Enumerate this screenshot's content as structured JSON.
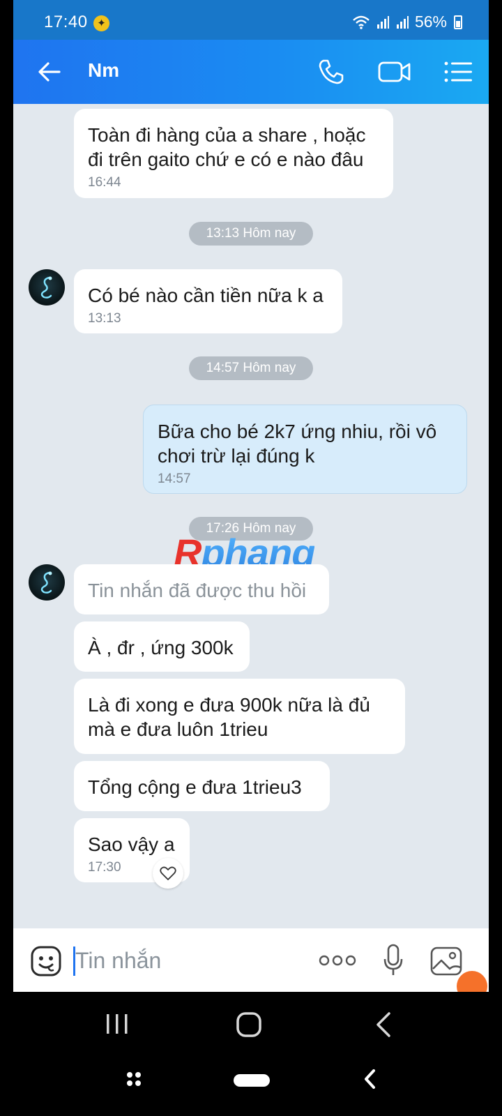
{
  "status_bar": {
    "time": "17:40",
    "battery": "56%"
  },
  "header": {
    "title": "Nm",
    "icons": [
      "back-arrow-icon",
      "phone-icon",
      "video-call-icon",
      "menu-list-icon"
    ]
  },
  "messages": {
    "m1": {
      "text": "Toàn đi hàng của a share , hoặc đi trên gaito chứ e có e nào đâu",
      "time": "16:44"
    },
    "sep1": "13:13 Hôm nay",
    "m2": {
      "text": "Có bé nào cần tiền nữa k a",
      "time": "13:13"
    },
    "sep2": "14:57 Hôm nay",
    "m3": {
      "text": "Bữa cho bé 2k7 ứng nhiu, rồi vô chơi trừ lại đúng k",
      "time": "14:57"
    },
    "sep3": "17:26 Hôm nay",
    "m4": {
      "text": "Tin nhắn đã được thu hồi"
    },
    "m5": {
      "text": "À , đr , ứng 300k"
    },
    "m6": {
      "text": "Là đi xong e đưa 900k nữa là đủ mà e đưa luôn 1trieu"
    },
    "m7": {
      "text": "Tổng cộng e đưa 1trieu3"
    },
    "m8": {
      "text": "Sao vậy a",
      "time": "17:30"
    }
  },
  "watermark": {
    "first": "R",
    "rest": "phang"
  },
  "input": {
    "placeholder": "Tin nhắn"
  },
  "colors": {
    "header_start": "#1f74f0",
    "header_end": "#1aa9f2",
    "chat_bg": "#e2e8ee",
    "sent_bubble": "#d7ecfb"
  }
}
